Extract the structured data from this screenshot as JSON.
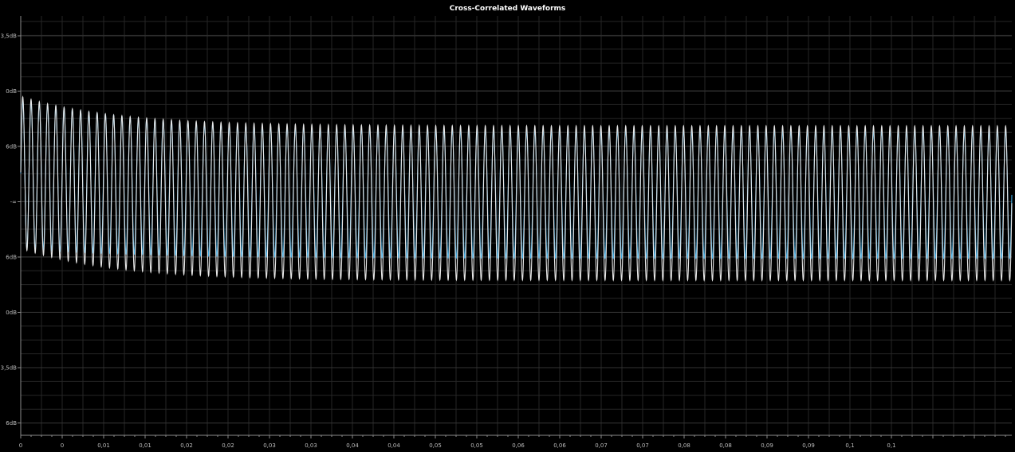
{
  "chart_data": {
    "type": "line",
    "title": "Cross-Correlated Waveforms",
    "xlabel": "",
    "ylabel": "",
    "x_tick_labels": [
      "0",
      "0",
      "0,01",
      "0,01",
      "0,02",
      "0,02",
      "0,03",
      "0,03",
      "0,04",
      "0,04",
      "0,05",
      "0,05",
      "0,06",
      "0,06",
      "0,07",
      "0,07",
      "0,08",
      "0,08",
      "0,09",
      "0,09",
      "0,1",
      "0,1"
    ],
    "y_tick_labels": [
      "3,5dB",
      "0dB",
      "6dB",
      "-∞",
      "6dB",
      "0dB",
      "3,5dB",
      "6dB"
    ],
    "xlim": [
      0,
      0.12
    ],
    "grid": true,
    "legend": "none",
    "series": [
      {
        "color": "#3fa9e0",
        "cycles": 120,
        "start_upper": 1.88,
        "end_upper": 1.28,
        "start_lower": -0.85,
        "end_lower": -1.03,
        "decay": 2.5
      },
      {
        "color": "#e8e8e8",
        "cycles": 120,
        "start_upper": 1.92,
        "end_upper": 1.38,
        "start_lower": -0.85,
        "end_lower": -1.43,
        "decay": 3.5
      }
    ]
  },
  "colors": {
    "background": "#000000",
    "grid": "#262626",
    "axis": "#8a8a8a",
    "text": "#bdbdbd"
  }
}
